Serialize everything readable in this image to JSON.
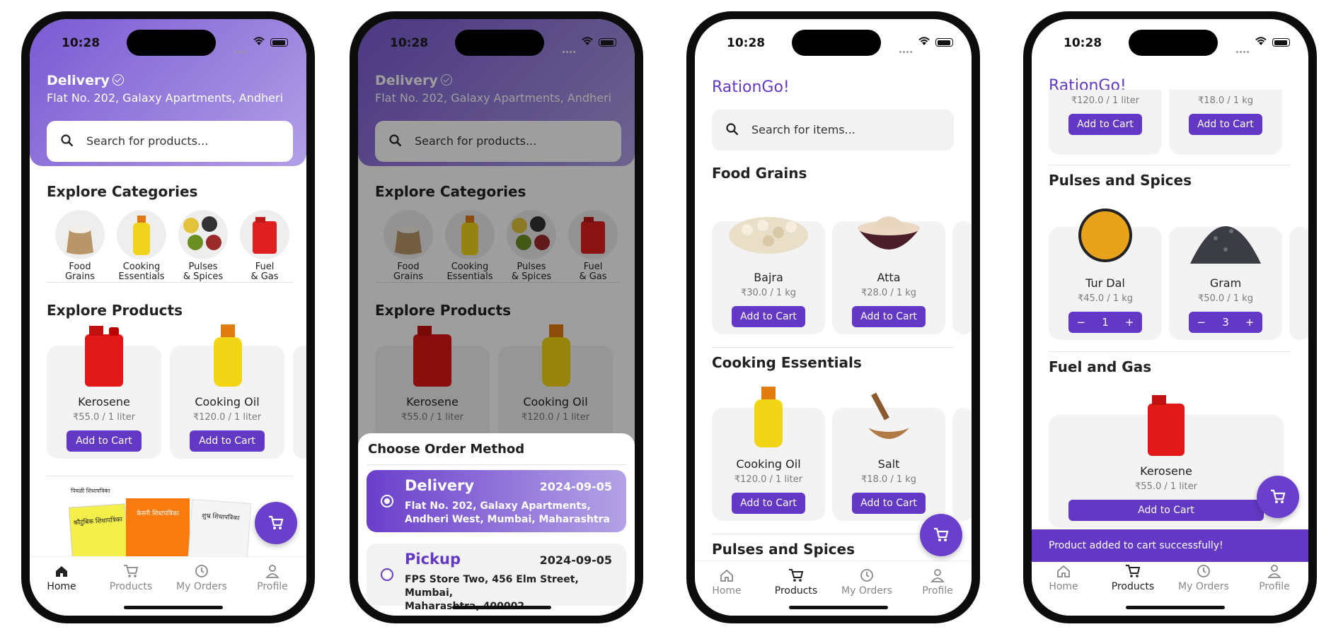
{
  "status": {
    "time": "10:28"
  },
  "header": {
    "delivery_label": "Delivery",
    "address": "Flat No. 202, Galaxy Apartments, Andheri"
  },
  "search": {
    "home_placeholder": "Search for products...",
    "products_placeholder": "Search for items..."
  },
  "brand": "RationGo!",
  "home": {
    "categories_title": "Explore Categories",
    "categories": [
      {
        "l1": "Food",
        "l2": "Grains"
      },
      {
        "l1": "Cooking",
        "l2": "Essentials"
      },
      {
        "l1": "Pulses",
        "l2": "& Spices"
      },
      {
        "l1": "Fuel",
        "l2": "& Gas"
      }
    ],
    "products_title": "Explore Products",
    "products": [
      {
        "name": "Kerosene",
        "price": "₹55.0 / 1 liter"
      },
      {
        "name": "Cooking Oil",
        "price": "₹120.0 / 1 liter"
      }
    ],
    "ration_cards": [
      "केसरी शिधापत्रिका",
      "पिवळी शिधापत्रिका",
      "शुभ्र शिधापत्रिका",
      "कौटुंबिक शिधापत्रिका"
    ]
  },
  "add_to_cart": "Add to Cart",
  "order_sheet": {
    "title": "Choose Order Method",
    "delivery": {
      "label": "Delivery",
      "date": "2024-09-05",
      "addr1": "Flat No. 202, Galaxy Apartments,",
      "addr2": "Andheri West, Mumbai, Maharashtra"
    },
    "pickup": {
      "label": "Pickup",
      "date": "2024-09-05",
      "addr1": "FPS Store Two, 456 Elm Street, Mumbai,",
      "addr2": "Maharashtra, 400002"
    }
  },
  "products_screen": {
    "food_grains": {
      "title": "Food Grains",
      "items": [
        {
          "name": "Bajra",
          "price": "₹30.0 / 1 kg"
        },
        {
          "name": "Atta",
          "price": "₹28.0 / 1 kg"
        }
      ]
    },
    "cooking": {
      "title": "Cooking Essentials",
      "items": [
        {
          "name": "Cooking Oil",
          "price": "₹120.0 / 1 liter"
        },
        {
          "name": "Salt",
          "price": "₹18.0 / 1 kg"
        }
      ]
    },
    "pulses_title": "Pulses and Spices"
  },
  "cart_screen": {
    "top_prices": [
      "₹120.0 / 1 liter",
      "₹18.0 / 1 kg"
    ],
    "pulses": {
      "title": "Pulses and Spices",
      "items": [
        {
          "name": "Tur Dal",
          "price": "₹45.0 / 1 kg",
          "qty": "1"
        },
        {
          "name": "Gram",
          "price": "₹50.0 / 1 kg",
          "qty": "3"
        }
      ]
    },
    "fuel": {
      "title": "Fuel and Gas",
      "item": {
        "name": "Kerosene",
        "price": "₹55.0 / 1 liter"
      }
    },
    "toast": "Product added to cart successfully!"
  },
  "stepper": {
    "minus": "−",
    "plus": "+"
  },
  "nav": {
    "home": "Home",
    "products": "Products",
    "orders": "My Orders",
    "profile": "Profile"
  },
  "colors": {
    "primary": "#6238c5",
    "gradient_start": "#7a5ad3",
    "gradient_end": "#b1a0e6"
  },
  "icons": [
    "search-icon",
    "cart-icon",
    "home-icon",
    "history-icon",
    "profile-icon",
    "check-circle-icon",
    "radio-icon"
  ]
}
